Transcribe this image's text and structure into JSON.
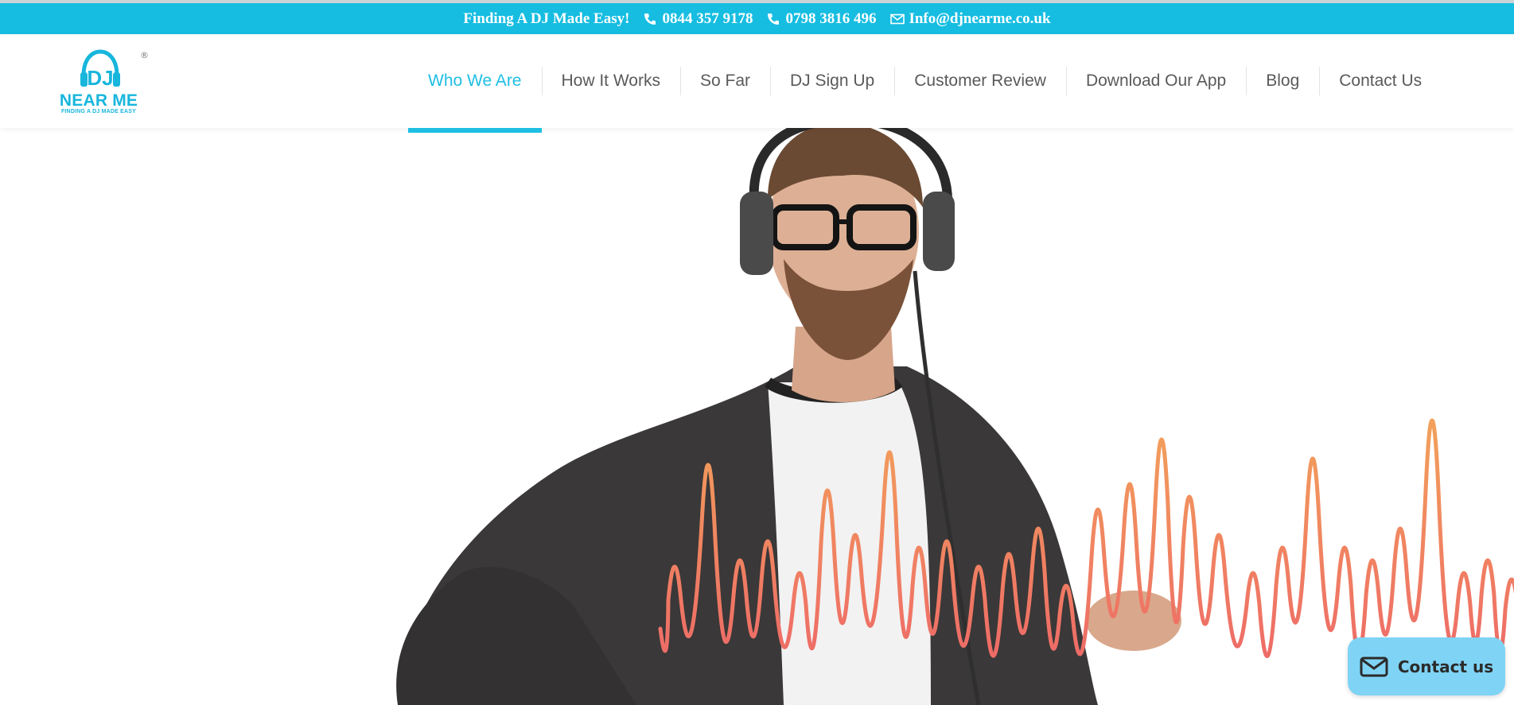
{
  "topbar": {
    "tagline": "Finding A DJ Made Easy!",
    "phone1": "0844 357 9178",
    "phone2": "0798 3816 496",
    "email": "Info@djnearme.co.uk",
    "background_color": "#16bde1"
  },
  "logo": {
    "mark_text": "DJ",
    "name": "NEAR ME",
    "tagline": "FINDING A DJ MADE EASY",
    "registered": "®"
  },
  "nav": {
    "items": [
      {
        "label": "Who We Are"
      },
      {
        "label": "How It Works"
      },
      {
        "label": "So Far"
      },
      {
        "label": "DJ Sign Up"
      },
      {
        "label": "Customer Review"
      },
      {
        "label": "Download Our App"
      },
      {
        "label": "Blog"
      },
      {
        "label": "Contact Us"
      }
    ],
    "active_index": 0,
    "accent_color": "#1ebfe3"
  },
  "hero": {
    "image": "dj-with-headphones-photo",
    "wave_colors": [
      "#f2a15a",
      "#ee6b67"
    ]
  },
  "contact_widget": {
    "label": "Contact us",
    "icon": "envelope-icon",
    "color": "#7fd4f5"
  }
}
